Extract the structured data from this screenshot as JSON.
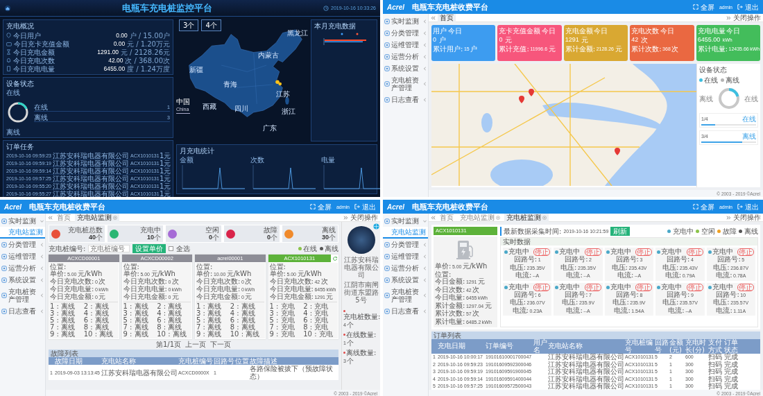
{
  "screens": [
    {
      "kind": "dashboard",
      "title": "电瓶车充电桩监控平台",
      "datetime": "2019-10-16 10:33:26",
      "overview": {
        "title": "充电概况",
        "rows": [
          {
            "label": "今日用户",
            "value": "0.00",
            "unit": "户",
            "total": "/ 15.00户"
          },
          {
            "label": "今日充卡充值金额",
            "value": "0.00",
            "unit": "元",
            "total": "/ 1.20万元"
          },
          {
            "label": "今日充电金额",
            "value": "1291.00",
            "unit": "元",
            "total": "/ 2128.26元"
          },
          {
            "label": "今日充电次数",
            "value": "42.00",
            "unit": "次",
            "total": "/ 368.00次"
          },
          {
            "label": "今日充电电量",
            "value": "6455.00",
            "unit": "度",
            "total": "/ 1.24万度"
          }
        ]
      },
      "device": {
        "title": "设备状态",
        "chart_labels": [
          "在线",
          "离线"
        ],
        "rows": [
          {
            "label": "在线",
            "count": "1"
          },
          {
            "label": "离线",
            "count": "3"
          }
        ]
      },
      "orders": {
        "title": "订单任务",
        "rows": [
          {
            "time": "2019-10-16 09:59:23",
            "company": "江苏安科瑞电器有限公司",
            "pile": "ACX1010131",
            "amount": "1元"
          },
          {
            "time": "2019-10-16 09:59:19",
            "company": "江苏安科瑞电器有限公司",
            "pile": "ACX1010131",
            "amount": "1元"
          },
          {
            "time": "2019-10-16 09:59:14",
            "company": "江苏安科瑞电器有限公司",
            "pile": "ACX1010131",
            "amount": "1元"
          },
          {
            "time": "2019-10-16 09:57:25",
            "company": "江苏安科瑞电器有限公司",
            "pile": "ACX1010131",
            "amount": "1元"
          },
          {
            "time": "2019-10-16 09:55:20",
            "company": "江苏安科瑞电器有限公司",
            "pile": "ACX1010131",
            "amount": "1元"
          },
          {
            "time": "2019-10-16 09:55:27",
            "company": "江苏安科瑞电器有限公司",
            "pile": "ACX1010131",
            "amount": "1元"
          }
        ]
      },
      "map": {
        "badges": [
          "3个",
          "4个"
        ],
        "legend": "中国",
        "legend_sub": "China",
        "provinces": [
          "新疆",
          "西藏",
          "青海",
          "内蒙古",
          "四川",
          "江苏",
          "浙江",
          "广东",
          "黑龙江"
        ]
      },
      "monthly": {
        "title": "本月充电数据"
      },
      "stats": {
        "title": "月充电统计",
        "charts": [
          "金额",
          "次数",
          "电量"
        ]
      }
    },
    {
      "kind": "home",
      "header": {
        "logo": "Acrel",
        "title": "电瓶车充电桩收费平台",
        "actions": [
          {
            "kind": "fullscreen",
            "label": "全屏"
          },
          {
            "kind": "user",
            "label": "admin"
          },
          {
            "kind": "logout",
            "label": "退出"
          }
        ]
      },
      "sidebar": [
        {
          "label": "实时监测",
          "expanded": false
        },
        {
          "label": "分类管理",
          "expanded": false
        },
        {
          "label": "运维管理",
          "expanded": false
        },
        {
          "label": "运营分析",
          "expanded": false
        },
        {
          "label": "系统设置",
          "expanded": false
        },
        {
          "label": "充电桩资产管理",
          "expanded": false
        },
        {
          "label": "日志查看",
          "expanded": false
        }
      ],
      "tabs": [
        {
          "label": "首页",
          "selected": true,
          "closable": false
        }
      ],
      "close_tabs": "关闭操作",
      "cards": [
        {
          "title": "用户",
          "tag": "今日",
          "value": "0",
          "unit": "户",
          "total_label": "累计用户:",
          "total_value": "15",
          "total_unit": "户",
          "color": "#3d9cf0"
        },
        {
          "title": "充卡充值金额",
          "tag": "今日",
          "value": "0",
          "unit": "元",
          "total_label": "累计充值:",
          "total_value": "11996.6",
          "total_unit": "元",
          "color": "#f7567c"
        },
        {
          "title": "充电金额",
          "tag": "今日",
          "value": "1291",
          "unit": "元",
          "total_label": "累计金额:",
          "total_value": "2128.26",
          "total_unit": "元",
          "color": "#d9a832"
        },
        {
          "title": "充电次数",
          "tag": "今日",
          "value": "42",
          "unit": "次",
          "total_label": "累计次数:",
          "total_value": "368",
          "total_unit": "次",
          "color": "#ea6841"
        },
        {
          "title": "充电电量",
          "tag": "今日",
          "value": "6455.00",
          "unit": "kWh",
          "total_label": "累计电量:",
          "total_value": "12435.66",
          "total_unit": "kWh",
          "color": "#43bd5b"
        }
      ],
      "device": {
        "title": "设备状态",
        "legend": [
          {
            "label": "在线",
            "color": "#3dbfe0"
          },
          {
            "label": "离线",
            "color": "#b5b5b5"
          }
        ],
        "chart_labels": [
          "离线",
          "在线"
        ],
        "bars": [
          {
            "count": "1/4",
            "label": "在线",
            "level": 0.25
          },
          {
            "count": "3/4",
            "label": "离线",
            "level": 0.75
          }
        ]
      },
      "footer": "© 2003 - 2019 ©Acrel"
    },
    {
      "kind": "station",
      "header": {
        "logo": "Acrel",
        "title": "电瓶车充电桩收费平台",
        "actions": [
          {
            "kind": "fullscreen",
            "label": "全屏"
          },
          {
            "kind": "user",
            "label": "admin"
          },
          {
            "kind": "logout",
            "label": "退出"
          }
        ]
      },
      "sidebar": [
        {
          "label": "实时监测",
          "expanded": true,
          "children": [
            {
              "label": "充电站监测",
              "selected": true
            }
          ]
        },
        {
          "label": "分类管理",
          "expanded": false
        },
        {
          "label": "运维管理",
          "expanded": false
        },
        {
          "label": "运营分析",
          "expanded": false
        },
        {
          "label": "系统设置",
          "expanded": false
        },
        {
          "label": "充电桩资产管理",
          "expanded": false
        },
        {
          "label": "日志查看",
          "expanded": false
        }
      ],
      "tabs": [
        {
          "label": "首页",
          "selected": false,
          "closable": false
        },
        {
          "label": "充电站监测",
          "selected": true,
          "closable": true
        }
      ],
      "close_tabs": "关闭操作",
      "stats": [
        {
          "label": "充电桩总数",
          "value": "40",
          "unit": "个",
          "color": "#e8503a"
        },
        {
          "label": "充电中",
          "value": "10",
          "unit": "个",
          "color": "#2bb673"
        },
        {
          "label": "空闲",
          "value": "0",
          "unit": "个",
          "color": "#a66bd6"
        },
        {
          "label": "故障",
          "value": "0",
          "unit": "个",
          "color": "#d9244a"
        },
        {
          "label": "离线",
          "value": "30",
          "unit": "个",
          "color": "#f08a2b"
        }
      ],
      "search": {
        "label": "充电桩编号:",
        "placeholder": "充电桩编号",
        "button": "设置单价",
        "select_all": {
          "label": "全选",
          "checked": false
        }
      },
      "legend": [
        {
          "label": "在线",
          "color": "#8bc34a"
        },
        {
          "label": "离线",
          "color": "#555555"
        }
      ],
      "piles": [
        {
          "code": "ACXCD00001",
          "online": false,
          "info": [
            {
              "label": "位置:"
            },
            {
              "label": "单价:",
              "value": "5.00",
              "unit": "元/kWh"
            },
            {
              "label": "今日充电次数:",
              "value": "0",
              "unit": "次"
            },
            {
              "label": "今日充电电量:",
              "value": "0",
              "unit": "kWh"
            },
            {
              "label": "今日充电金额:",
              "value": "0",
              "unit": "元"
            }
          ],
          "ports": [
            "1 : 离线",
            "2 : 离线",
            "3 : 离线",
            "4 : 离线",
            "5 : 离线",
            "6 : 离线",
            "7 : 离线",
            "8 : 离线",
            "9 : 离线",
            "10 : 离线"
          ]
        },
        {
          "code": "ACXCD00002",
          "online": false,
          "info": [
            {
              "label": "位置:"
            },
            {
              "label": "单价:",
              "value": "5.00",
              "unit": "元/kWh"
            },
            {
              "label": "今日充电次数:",
              "value": "0",
              "unit": "次"
            },
            {
              "label": "今日充电电量:",
              "value": "0",
              "unit": "kWh"
            },
            {
              "label": "今日充电金额:",
              "value": "0",
              "unit": "元"
            }
          ],
          "ports": [
            "1 : 离线",
            "2 : 离线",
            "3 : 离线",
            "4 : 离线",
            "5 : 离线",
            "6 : 离线",
            "7 : 离线",
            "8 : 离线",
            "9 : 离线",
            "10 : 离线"
          ]
        },
        {
          "code": "acrel00001",
          "online": false,
          "info": [
            {
              "label": "位置:"
            },
            {
              "label": "单价:",
              "value": "10.00",
              "unit": "元/kWh"
            },
            {
              "label": "今日充电次数:",
              "value": "0",
              "unit": "次"
            },
            {
              "label": "今日充电电量:",
              "value": "0",
              "unit": "kWh"
            },
            {
              "label": "今日充电金额:",
              "value": "0",
              "unit": "元"
            }
          ],
          "ports": [
            "1 : 离线",
            "2 : 离线",
            "3 : 离线",
            "4 : 离线",
            "5 : 离线",
            "6 : 离线",
            "7 : 离线",
            "8 : 离线",
            "9 : 离线",
            "10 : 离线"
          ]
        },
        {
          "code": "ACX1010131",
          "online": true,
          "info": [
            {
              "label": "位置:"
            },
            {
              "label": "单价:",
              "value": "5.00",
              "unit": "元/kWh"
            },
            {
              "label": "今日充电次数:",
              "value": "42",
              "unit": "次"
            },
            {
              "label": "今日充电电量:",
              "value": "6455",
              "unit": "kWh"
            },
            {
              "label": "今日充电金额:",
              "value": "1291",
              "unit": "元"
            }
          ],
          "ports": [
            "1 : 充电",
            "2 : 充电",
            "3 : 充电",
            "4 : 充电",
            "5 : 充电",
            "6 : 充电",
            "7 : 充电",
            "8 : 充电",
            "9 : 充电",
            "10 : 充电"
          ]
        }
      ],
      "pager": {
        "info": "第1/1页",
        "prev": "上一页",
        "next": "下一页"
      },
      "faults": {
        "title": "故障列表",
        "columns": [
          "故障日期",
          "充电站名称",
          "充电桩编号",
          "回路号",
          "位置",
          "故障描述"
        ],
        "rows": [
          {
            "index": "1",
            "date": "2019-09-03 13:13:45",
            "station": "江苏安科瑞电器有限公司",
            "pile": "ACXCD0000X",
            "port": "1",
            "description": "各路保险被拔下（预故障状态）"
          }
        ]
      },
      "profile": {
        "company": "江苏安科瑞电器有限公司",
        "address": "江阴市南闸街道东盟路5号",
        "facts": [
          {
            "label": "充电桩数量:",
            "value": "4",
            "unit": "个"
          },
          {
            "label": "在线数量:",
            "value": "1",
            "unit": "个"
          },
          {
            "label": "离线数量:",
            "value": "3",
            "unit": "个"
          }
        ]
      },
      "footer": "© 2003 - 2019 ©Acrel"
    },
    {
      "kind": "pile",
      "header": {
        "logo": "Acrel",
        "title": "电瓶车充电桩收费平台",
        "actions": [
          {
            "kind": "fullscreen",
            "label": "全屏"
          },
          {
            "kind": "user",
            "label": "admin"
          },
          {
            "kind": "logout",
            "label": "退出"
          }
        ]
      },
      "sidebar": [
        {
          "label": "实时监测",
          "expanded": true,
          "children": [
            {
              "label": "充电站监测",
              "selected": true
            }
          ]
        },
        {
          "label": "分类管理",
          "expanded": false
        },
        {
          "label": "运维管理",
          "expanded": false
        },
        {
          "label": "运营分析",
          "expanded": false
        },
        {
          "label": "系统设置",
          "expanded": false
        },
        {
          "label": "充电桩资产管理",
          "expanded": false
        },
        {
          "label": "日志查看",
          "expanded": false
        }
      ],
      "tabs": [
        {
          "label": "首页",
          "selected": false,
          "closable": false
        },
        {
          "label": "充电站监测",
          "selected": false,
          "closable": true
        },
        {
          "label": "充电桩监测",
          "selected": true,
          "closable": true
        }
      ],
      "close_tabs": "关闭操作",
      "pile": {
        "code": "ACX1010131",
        "info": [
          {
            "label": "单价:",
            "value": "5.00",
            "unit": "元/kWh"
          },
          {
            "label": "位置:"
          },
          {
            "label": "今日金额:",
            "value": "1291",
            "unit": "元"
          },
          {
            "label": "今日次数:",
            "value": "42",
            "unit": "次"
          },
          {
            "label": "今日电量:",
            "value": "6455",
            "unit": "kWh"
          },
          {
            "label": "累计金额:",
            "value": "1297.04",
            "unit": "元"
          },
          {
            "label": "累计次数:",
            "value": "57",
            "unit": "次"
          },
          {
            "label": "累计电量:",
            "value": "6485.2",
            "unit": "kWh"
          }
        ]
      },
      "collect": {
        "label": "最新数据采集时间:",
        "time": "2019-10-16 10:21:59",
        "button": "刷新"
      },
      "legend": [
        {
          "label": "充电中",
          "color": "#4aa8c8"
        },
        {
          "label": "空闲",
          "color": "#8bc34a"
        },
        {
          "label": "故障",
          "color": "#f0a020"
        },
        {
          "label": "离线",
          "color": "#555555"
        }
      ],
      "realtime": {
        "title": "实时数据",
        "ports": [
          {
            "status": "充电中",
            "color": "#4aa8c8",
            "tag": "停止",
            "port_label": "回路号:",
            "port": "1",
            "voltage_label": "电压:",
            "voltage": "235.35V",
            "current_label": "电流:",
            "current": "--A"
          },
          {
            "status": "充电中",
            "color": "#4aa8c8",
            "tag": "停止",
            "port_label": "回路号:",
            "port": "2",
            "voltage_label": "电压:",
            "voltage": "235.35V",
            "current_label": "电流:",
            "current": "--A"
          },
          {
            "status": "充电中",
            "color": "#4aa8c8",
            "tag": "停止",
            "port_label": "回路号:",
            "port": "3",
            "voltage_label": "电压:",
            "voltage": "235.43V",
            "current_label": "电流:",
            "current": "--A"
          },
          {
            "status": "充电中",
            "color": "#4aa8c8",
            "tag": "停止",
            "port_label": "回路号:",
            "port": "4",
            "voltage_label": "电压:",
            "voltage": "235.43V",
            "current_label": "电流:",
            "current": "0.79A"
          },
          {
            "status": "充电中",
            "color": "#4aa8c8",
            "tag": "停止",
            "port_label": "回路号:",
            "port": "5",
            "voltage_label": "电压:",
            "voltage": "236.87V",
            "current_label": "电流:",
            "current": "0.78A"
          },
          {
            "status": "充电中",
            "color": "#4aa8c8",
            "tag": "停止",
            "port_label": "回路号:",
            "port": "6",
            "voltage_label": "电压:",
            "voltage": "236.07V",
            "current_label": "电流:",
            "current": "0.23A"
          },
          {
            "status": "充电中",
            "color": "#4aa8c8",
            "tag": "停止",
            "port_label": "回路号:",
            "port": "7",
            "voltage_label": "电压:",
            "voltage": "235.9V",
            "current_label": "电流:",
            "current": "--A"
          },
          {
            "status": "充电中",
            "color": "#4aa8c8",
            "tag": "停止",
            "port_label": "回路号:",
            "port": "8",
            "voltage_label": "电压:",
            "voltage": "235.9V",
            "current_label": "电流:",
            "current": "1.54A"
          },
          {
            "status": "充电中",
            "color": "#4aa8c8",
            "tag": "停止",
            "port_label": "回路号:",
            "port": "9",
            "voltage_label": "电压:",
            "voltage": "235.57V",
            "current_label": "电流:",
            "current": "--A"
          },
          {
            "status": "充电中",
            "color": "#4aa8c8",
            "tag": "停止",
            "port_label": "回路号:",
            "port": "10",
            "voltage_label": "电压:",
            "voltage": "235.57V",
            "current_label": "电流:",
            "current": "1.11A"
          }
        ]
      },
      "orders": {
        "title": "订单列表",
        "columns": [
          "充电日期",
          "订单编号",
          "用户名",
          "充电站名称",
          "充电桩编号",
          "回路号",
          "金额(元)",
          "充电时长(分)",
          "支付方式",
          "订单状态"
        ],
        "rows": [
          {
            "index": "1",
            "date": "2019-10-16 10:00:17",
            "number": "19101610001700047",
            "station": "江苏安科瑞电器有限公司",
            "pile": "ACX1010131",
            "port": "5",
            "amount": "2",
            "minutes": "600",
            "payment": "扫码",
            "status": "完成"
          },
          {
            "index": "2",
            "date": "2019-10-16 09:59:23",
            "number": "19101609592300046",
            "station": "江苏安科瑞电器有限公司",
            "pile": "ACX1010131",
            "port": "5",
            "amount": "1",
            "minutes": "300",
            "payment": "扫码",
            "status": "完成"
          },
          {
            "index": "3",
            "date": "2019-10-16 09:59:19",
            "number": "19101609591900045",
            "station": "江苏安科瑞电器有限公司",
            "pile": "ACX1010131",
            "port": "5",
            "amount": "1",
            "minutes": "300",
            "payment": "扫码",
            "status": "完成"
          },
          {
            "index": "4",
            "date": "2019-10-16 09:59:14",
            "number": "19101609591400044",
            "station": "江苏安科瑞电器有限公司",
            "pile": "ACX1010131",
            "port": "5",
            "amount": "1",
            "minutes": "300",
            "payment": "扫码",
            "status": "完成"
          },
          {
            "index": "5",
            "date": "2019-10-16 09:57:25",
            "number": "19101609572500043",
            "station": "江苏安科瑞电器有限公司",
            "pile": "ACX1010131",
            "port": "5",
            "amount": "1",
            "minutes": "300",
            "payment": "扫码",
            "status": "完成"
          }
        ]
      },
      "footer": "© 2003 - 2019 ©Acrel"
    }
  ]
}
